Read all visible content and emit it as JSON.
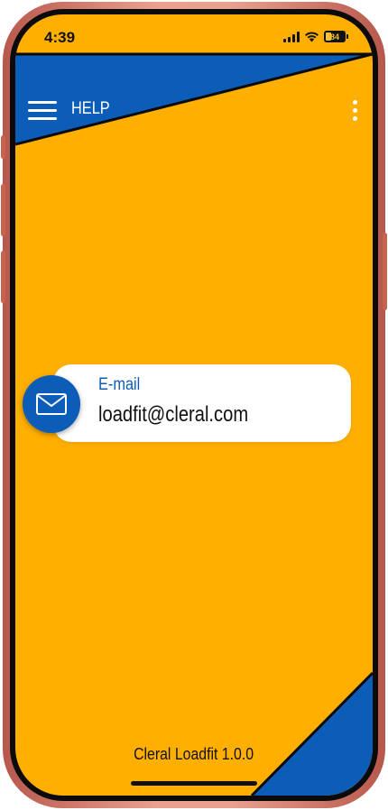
{
  "status_bar": {
    "time": "4:39",
    "battery_level": "84",
    "battery_percent": 0.3
  },
  "app_bar": {
    "menu_icon": "hamburger-menu-icon",
    "title": "HELP",
    "more_icon": "more-vertical-icon"
  },
  "contact": {
    "icon": "mail-icon",
    "label": "E-mail",
    "value": "loadfit@cleral.com"
  },
  "footer": {
    "version": "Cleral Loadfit 1.0.0"
  },
  "colors": {
    "background": "#FFAF00",
    "accent": "#0B5DB8",
    "card": "#FFFFFF",
    "frame": "#D9897A"
  }
}
